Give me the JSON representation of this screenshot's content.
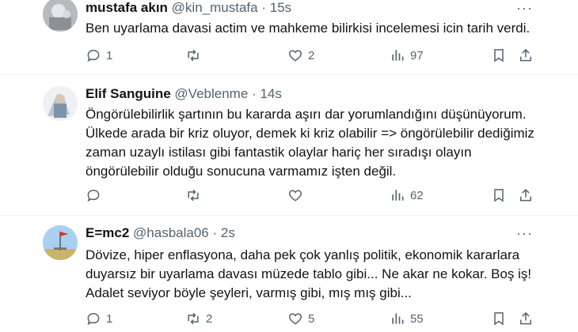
{
  "tweets": [
    {
      "name": "mustafa akın",
      "handle": "@kin_mustafa",
      "dot": "·",
      "time": "15s",
      "text": "Ben uyarlama davasi actim ve mahkeme bilirkisi incelemesi icin tarih verdi.",
      "replies": "1",
      "retweets": "",
      "likes": "2",
      "views": "97"
    },
    {
      "name": "Elif Sanguine",
      "handle": "@Veblenme",
      "dot": "·",
      "time": "14s",
      "text_lines": [
        "Öngörülebilirlik şartının bu kararda aşırı dar yorumlandığını düşünüyorum.",
        "Ülkede arada bir kriz oluyor, demek ki kriz olabilir => öngörülebilir dediğimiz",
        "zaman uzaylı istilası gibi fantastik olaylar hariç her sıradışı olayın",
        "öngörülebilir olduğu sonucuna varmamız işten değil."
      ],
      "replies": "",
      "retweets": "",
      "likes": "",
      "views": "62"
    },
    {
      "name": "E=mc2",
      "handle": "@hasbala06",
      "dot": "·",
      "time": "2s",
      "text_lines": [
        "Dövize, hiper enflasyona, daha pek çok yanlış politik, ekonomik kararlara",
        "duyarsız bir uyarlama davası müzede tablo gibi... Ne akar ne kokar. Boş iş!",
        "Adalet seviyor böyle şeyleri, varmış gibi, mış mış gibi..."
      ],
      "replies": "1",
      "retweets": "2",
      "likes": "5",
      "views": "55"
    }
  ],
  "icons": [
    "reply-icon",
    "retweet-icon",
    "like-icon",
    "views-icon",
    "bookmark-icon",
    "share-icon",
    "more-icon"
  ],
  "colors": {
    "text": "#0f1419",
    "secondary": "#536471",
    "divider": "#eff3f4"
  }
}
